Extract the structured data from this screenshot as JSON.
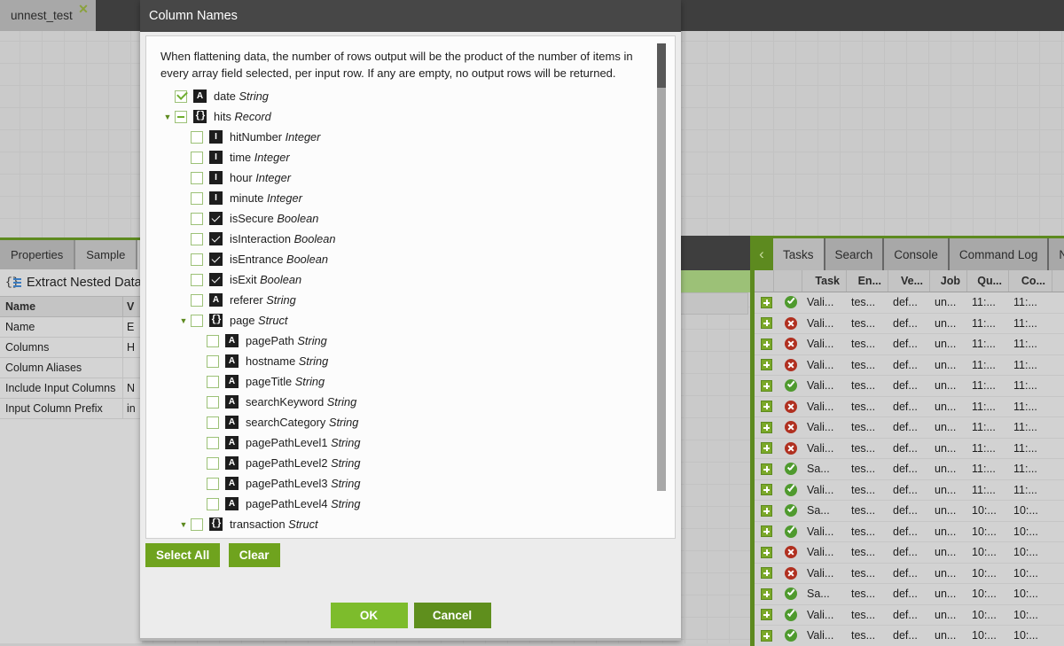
{
  "document_tab": {
    "label": "unnest_test",
    "close_icon": "close-icon"
  },
  "properties_panel": {
    "tabs": [
      {
        "label": "Properties",
        "active": true
      },
      {
        "label": "Sample",
        "active": false
      }
    ],
    "title": "Extract Nested Data",
    "title_icon": "nested-data-icon",
    "headers": {
      "name": "Name",
      "value": "V"
    },
    "rows": [
      {
        "name": "Name",
        "value": "E"
      },
      {
        "name": "Columns",
        "value": "H"
      },
      {
        "name": "Column Aliases",
        "value": ""
      },
      {
        "name": "Include Input Columns",
        "value": "N"
      },
      {
        "name": "Input Column Prefix",
        "value": "in"
      }
    ]
  },
  "right_panel": {
    "collapse_icon": "chevron-left-icon",
    "tabs": [
      {
        "label": "Tasks",
        "active": true
      },
      {
        "label": "Search",
        "active": false
      },
      {
        "label": "Console",
        "active": false
      },
      {
        "label": "Command Log",
        "active": false
      },
      {
        "label": "No",
        "active": false
      }
    ],
    "table": {
      "columns": [
        "",
        "",
        "Task",
        "En...",
        "Ve...",
        "Job",
        "Qu...",
        "Co..."
      ],
      "rows": [
        {
          "expand": "+",
          "status": "ok",
          "task": "Vali...",
          "en": "tes...",
          "ve": "def...",
          "job": "un...",
          "qu": "11:...",
          "co": "11:..."
        },
        {
          "expand": "+",
          "status": "err",
          "task": "Vali...",
          "en": "tes...",
          "ve": "def...",
          "job": "un...",
          "qu": "11:...",
          "co": "11:..."
        },
        {
          "expand": "+",
          "status": "err",
          "task": "Vali...",
          "en": "tes...",
          "ve": "def...",
          "job": "un...",
          "qu": "11:...",
          "co": "11:..."
        },
        {
          "expand": "+",
          "status": "err",
          "task": "Vali...",
          "en": "tes...",
          "ve": "def...",
          "job": "un...",
          "qu": "11:...",
          "co": "11:..."
        },
        {
          "expand": "+",
          "status": "ok",
          "task": "Vali...",
          "en": "tes...",
          "ve": "def...",
          "job": "un...",
          "qu": "11:...",
          "co": "11:..."
        },
        {
          "expand": "+",
          "status": "err",
          "task": "Vali...",
          "en": "tes...",
          "ve": "def...",
          "job": "un...",
          "qu": "11:...",
          "co": "11:..."
        },
        {
          "expand": "+",
          "status": "err",
          "task": "Vali...",
          "en": "tes...",
          "ve": "def...",
          "job": "un...",
          "qu": "11:...",
          "co": "11:..."
        },
        {
          "expand": "+",
          "status": "err",
          "task": "Vali...",
          "en": "tes...",
          "ve": "def...",
          "job": "un...",
          "qu": "11:...",
          "co": "11:..."
        },
        {
          "expand": "+",
          "status": "ok",
          "task": "Sa...",
          "en": "tes...",
          "ve": "def...",
          "job": "un...",
          "qu": "11:...",
          "co": "11:..."
        },
        {
          "expand": "+",
          "status": "ok",
          "task": "Vali...",
          "en": "tes...",
          "ve": "def...",
          "job": "un...",
          "qu": "11:...",
          "co": "11:..."
        },
        {
          "expand": "+",
          "status": "ok",
          "task": "Sa...",
          "en": "tes...",
          "ve": "def...",
          "job": "un...",
          "qu": "10:...",
          "co": "10:..."
        },
        {
          "expand": "+",
          "status": "ok",
          "task": "Vali...",
          "en": "tes...",
          "ve": "def...",
          "job": "un...",
          "qu": "10:...",
          "co": "10:..."
        },
        {
          "expand": "+",
          "status": "err",
          "task": "Vali...",
          "en": "tes...",
          "ve": "def...",
          "job": "un...",
          "qu": "10:...",
          "co": "10:..."
        },
        {
          "expand": "+",
          "status": "err",
          "task": "Vali...",
          "en": "tes...",
          "ve": "def...",
          "job": "un...",
          "qu": "10:...",
          "co": "10:..."
        },
        {
          "expand": "+",
          "status": "ok",
          "task": "Sa...",
          "en": "tes...",
          "ve": "def...",
          "job": "un...",
          "qu": "10:...",
          "co": "10:..."
        },
        {
          "expand": "+",
          "status": "ok",
          "task": "Vali...",
          "en": "tes...",
          "ve": "def...",
          "job": "un...",
          "qu": "10:...",
          "co": "10:..."
        },
        {
          "expand": "+",
          "status": "ok",
          "task": "Vali...",
          "en": "tes...",
          "ve": "def...",
          "job": "un...",
          "qu": "10:...",
          "co": "10:..."
        }
      ]
    }
  },
  "dialog": {
    "title": "Column Names",
    "description": "When flattening data, the number of rows output will be the product of the number of items in every array field selected, per input row. If any are empty, no output rows will be returned.",
    "tree": [
      {
        "indent": 0,
        "twisty": "",
        "check": "checked",
        "icon": "A",
        "icon_kind": "string",
        "name": "date",
        "type": "String"
      },
      {
        "indent": 0,
        "twisty": "open",
        "check": "partial",
        "icon": "{}",
        "icon_kind": "record",
        "name": "hits",
        "type": "Record"
      },
      {
        "indent": 1,
        "twisty": "",
        "check": "none",
        "icon": "I",
        "icon_kind": "integer",
        "name": "hitNumber",
        "type": "Integer"
      },
      {
        "indent": 1,
        "twisty": "",
        "check": "none",
        "icon": "I",
        "icon_kind": "integer",
        "name": "time",
        "type": "Integer"
      },
      {
        "indent": 1,
        "twisty": "",
        "check": "none",
        "icon": "I",
        "icon_kind": "integer",
        "name": "hour",
        "type": "Integer"
      },
      {
        "indent": 1,
        "twisty": "",
        "check": "none",
        "icon": "I",
        "icon_kind": "integer",
        "name": "minute",
        "type": "Integer"
      },
      {
        "indent": 1,
        "twisty": "",
        "check": "none",
        "icon": "",
        "icon_kind": "boolean",
        "name": "isSecure",
        "type": "Boolean"
      },
      {
        "indent": 1,
        "twisty": "",
        "check": "none",
        "icon": "",
        "icon_kind": "boolean",
        "name": "isInteraction",
        "type": "Boolean"
      },
      {
        "indent": 1,
        "twisty": "",
        "check": "none",
        "icon": "",
        "icon_kind": "boolean",
        "name": "isEntrance",
        "type": "Boolean"
      },
      {
        "indent": 1,
        "twisty": "",
        "check": "none",
        "icon": "",
        "icon_kind": "boolean",
        "name": "isExit",
        "type": "Boolean"
      },
      {
        "indent": 1,
        "twisty": "",
        "check": "none",
        "icon": "A",
        "icon_kind": "string",
        "name": "referer",
        "type": "String"
      },
      {
        "indent": 1,
        "twisty": "open",
        "check": "none",
        "icon": "{}",
        "icon_kind": "record",
        "name": "page",
        "type": "Struct"
      },
      {
        "indent": 2,
        "twisty": "",
        "check": "none",
        "icon": "A",
        "icon_kind": "string",
        "name": "pagePath",
        "type": "String"
      },
      {
        "indent": 2,
        "twisty": "",
        "check": "none",
        "icon": "A",
        "icon_kind": "string",
        "name": "hostname",
        "type": "String"
      },
      {
        "indent": 2,
        "twisty": "",
        "check": "none",
        "icon": "A",
        "icon_kind": "string",
        "name": "pageTitle",
        "type": "String"
      },
      {
        "indent": 2,
        "twisty": "",
        "check": "none",
        "icon": "A",
        "icon_kind": "string",
        "name": "searchKeyword",
        "type": "String"
      },
      {
        "indent": 2,
        "twisty": "",
        "check": "none",
        "icon": "A",
        "icon_kind": "string",
        "name": "searchCategory",
        "type": "String"
      },
      {
        "indent": 2,
        "twisty": "",
        "check": "none",
        "icon": "A",
        "icon_kind": "string",
        "name": "pagePathLevel1",
        "type": "String"
      },
      {
        "indent": 2,
        "twisty": "",
        "check": "none",
        "icon": "A",
        "icon_kind": "string",
        "name": "pagePathLevel2",
        "type": "String"
      },
      {
        "indent": 2,
        "twisty": "",
        "check": "none",
        "icon": "A",
        "icon_kind": "string",
        "name": "pagePathLevel3",
        "type": "String"
      },
      {
        "indent": 2,
        "twisty": "",
        "check": "none",
        "icon": "A",
        "icon_kind": "string",
        "name": "pagePathLevel4",
        "type": "String"
      },
      {
        "indent": 1,
        "twisty": "open",
        "check": "none",
        "icon": "{}",
        "icon_kind": "record",
        "name": "transaction",
        "type": "Struct"
      }
    ],
    "select_all_label": "Select All",
    "clear_label": "Clear",
    "ok_label": "OK",
    "cancel_label": "Cancel"
  },
  "colors": {
    "accent_green": "#6fa31e",
    "accent_green_light": "#7dbc2c",
    "accent_green_dark": "#5f8f1d",
    "header_dark": "#474747",
    "status_ok": "#4f9a2e",
    "status_err": "#b03020"
  }
}
